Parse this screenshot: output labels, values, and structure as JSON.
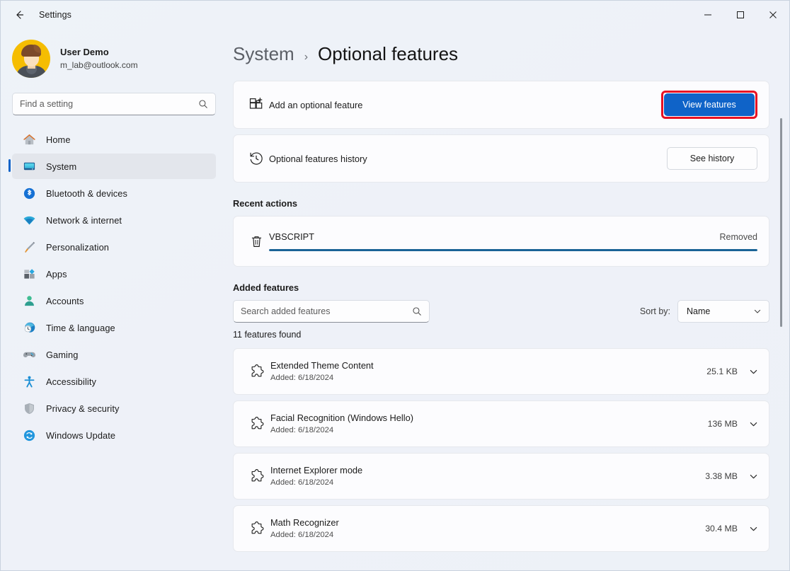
{
  "window": {
    "title": "Settings",
    "back_icon": "back-arrow-icon",
    "minimize_label": "Minimize",
    "maximize_label": "Maximize",
    "close_label": "Close"
  },
  "profile": {
    "name": "User Demo",
    "email": "m_lab@outlook.com"
  },
  "search": {
    "placeholder": "Find a setting",
    "value": "",
    "icon": "search-icon"
  },
  "sidebar": {
    "items": [
      {
        "label": "Home",
        "icon": "home-icon",
        "selected": false
      },
      {
        "label": "System",
        "icon": "system-display-icon",
        "selected": true
      },
      {
        "label": "Bluetooth & devices",
        "icon": "bluetooth-icon",
        "selected": false
      },
      {
        "label": "Network & internet",
        "icon": "wifi-icon",
        "selected": false
      },
      {
        "label": "Personalization",
        "icon": "paintbrush-icon",
        "selected": false
      },
      {
        "label": "Apps",
        "icon": "apps-icon",
        "selected": false
      },
      {
        "label": "Accounts",
        "icon": "person-icon",
        "selected": false
      },
      {
        "label": "Time & language",
        "icon": "clock-globe-icon",
        "selected": false
      },
      {
        "label": "Gaming",
        "icon": "gamepad-icon",
        "selected": false
      },
      {
        "label": "Accessibility",
        "icon": "accessibility-icon",
        "selected": false
      },
      {
        "label": "Privacy & security",
        "icon": "shield-icon",
        "selected": false
      },
      {
        "label": "Windows Update",
        "icon": "update-refresh-icon",
        "selected": false
      }
    ]
  },
  "breadcrumb": {
    "parent": "System",
    "separator": "›",
    "current": "Optional features"
  },
  "cards": {
    "add_feature": {
      "icon": "add-grid-plus-icon",
      "title": "Add an optional feature",
      "button_label": "View features",
      "button_highlighted": true,
      "highlight_color": "#e81123",
      "accent_color": "#0f63c8"
    },
    "history": {
      "icon": "history-clock-icon",
      "title": "Optional features history",
      "button_label": "See history"
    }
  },
  "recent_actions": {
    "section_title": "Recent actions",
    "items": [
      {
        "icon": "trash-icon",
        "name": "VBSCRIPT",
        "status": "Removed",
        "progress_percent": 100,
        "progress_color": "#1a6396"
      }
    ]
  },
  "added_features": {
    "section_title": "Added features",
    "search_placeholder": "Search added features",
    "search_value": "",
    "search_icon": "search-icon",
    "sort_label": "Sort by:",
    "sort_value": "Name",
    "sort_chevron": "chevron-down-icon",
    "found_text": "11 features found",
    "items": [
      {
        "icon": "puzzle-piece-icon",
        "name": "Extended Theme Content",
        "added": "Added: 6/18/2024",
        "size": "25.1 KB",
        "chevron": "chevron-down-icon"
      },
      {
        "icon": "puzzle-piece-icon",
        "name": "Facial Recognition (Windows Hello)",
        "added": "Added: 6/18/2024",
        "size": "136 MB",
        "chevron": "chevron-down-icon"
      },
      {
        "icon": "puzzle-piece-icon",
        "name": "Internet Explorer mode",
        "added": "Added: 6/18/2024",
        "size": "3.38 MB",
        "chevron": "chevron-down-icon"
      },
      {
        "icon": "puzzle-piece-icon",
        "name": "Math Recognizer",
        "added": "Added: 6/18/2024",
        "size": "30.4 MB",
        "chevron": "chevron-down-icon"
      }
    ]
  },
  "scrollbar": {
    "name": "vertical-scrollbar"
  }
}
